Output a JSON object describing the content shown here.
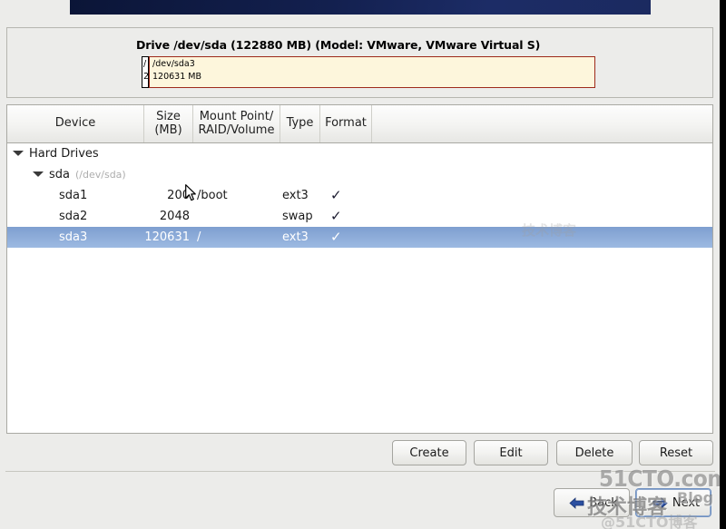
{
  "window": {
    "banner_color": "#13204f",
    "background_color": "#ececea"
  },
  "drive_panel": {
    "title": "Drive /dev/sda (122880 MB) (Model: VMware, VMware Virtual S)",
    "segments": [
      {
        "name": "/",
        "size": "2",
        "kind": "small",
        "fill": "#ffffff"
      },
      {
        "name": "/dev/sda3",
        "size": "120631 MB",
        "kind": "big",
        "fill": "#fdf6dc"
      }
    ]
  },
  "table": {
    "headers": {
      "device": "Device",
      "size_line1": "Size",
      "size_line2": "(MB)",
      "mount_line1": "Mount Point/",
      "mount_line2": "RAID/Volume",
      "type": "Type",
      "format": "Format"
    },
    "rows": [
      {
        "level": 0,
        "expander": "expanded",
        "device": "Hard Drives",
        "device_sub": "",
        "size": "",
        "mount": "",
        "type": "",
        "format": "",
        "selected": false
      },
      {
        "level": 1,
        "expander": "expanded",
        "device": "sda",
        "device_sub": "(/dev/sda)",
        "size": "",
        "mount": "",
        "type": "",
        "format": "",
        "selected": false
      },
      {
        "level": 2,
        "expander": "none",
        "device": "sda1",
        "device_sub": "",
        "size": "200",
        "mount": "/boot",
        "type": "ext3",
        "format": "✓",
        "selected": false
      },
      {
        "level": 2,
        "expander": "none",
        "device": "sda2",
        "device_sub": "",
        "size": "2048",
        "mount": "",
        "type": "swap",
        "format": "✓",
        "selected": false
      },
      {
        "level": 2,
        "expander": "none",
        "device": "sda3",
        "device_sub": "",
        "size": "120631",
        "mount": "/",
        "type": "ext3",
        "format": "✓",
        "selected": true
      }
    ],
    "selection_color": "#8cabd8"
  },
  "actions": {
    "create": "Create",
    "edit": "Edit",
    "delete": "Delete",
    "reset": "Reset"
  },
  "nav": {
    "back": "Back",
    "next": "Next",
    "back_arrow_color": "#2b4fa0",
    "next_arrow_color": "#2b4fa0"
  },
  "watermark": {
    "site": "51CTO.com",
    "cn_text": "技术博客",
    "blog": "Blog",
    "handle": "@51CTO博客",
    "center": "技术博客"
  }
}
